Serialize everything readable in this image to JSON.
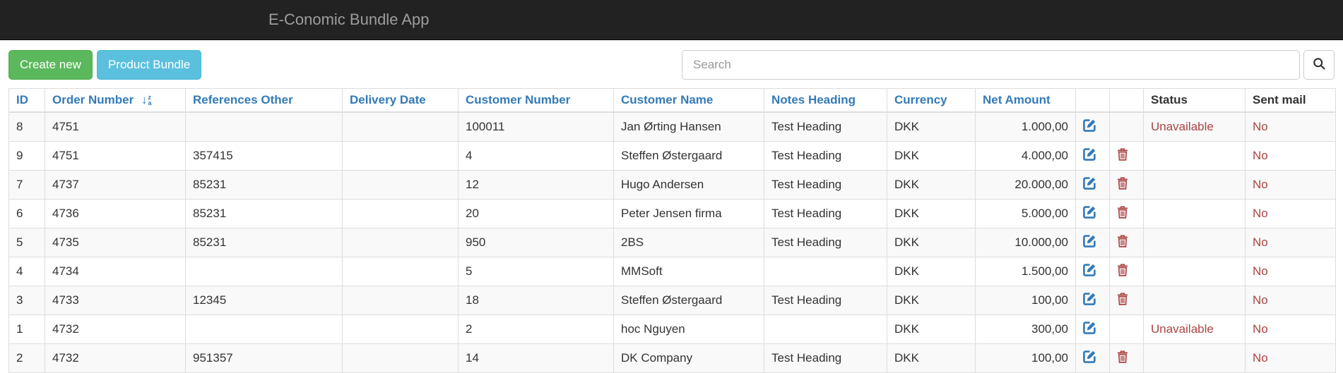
{
  "navbar": {
    "title": "E-Conomic Bundle App",
    "bg_color": "#222222",
    "title_color": "#9d9d9d"
  },
  "toolbar": {
    "create_label": "Create new",
    "bundle_label": "Product Bundle",
    "create_color": "#5cb85c",
    "bundle_color": "#5bc0de",
    "search_placeholder": "Search",
    "search_value": "",
    "search_icon": "magnifier"
  },
  "table": {
    "link_color": "#337ab7",
    "danger_color": "#a94442",
    "stripe_color": "#f9f9f9",
    "sort_icon": "sort-alpha-desc",
    "edit_icon": "pencil-square",
    "delete_icon": "trash",
    "columns": [
      {
        "key": "id",
        "label": "ID",
        "link": true
      },
      {
        "key": "order_number",
        "label": "Order Number",
        "link": true,
        "sorted": true
      },
      {
        "key": "references_other",
        "label": "References Other",
        "link": true
      },
      {
        "key": "delivery_date",
        "label": "Delivery Date",
        "link": true
      },
      {
        "key": "customer_number",
        "label": "Customer Number",
        "link": true
      },
      {
        "key": "customer_name",
        "label": "Customer Name",
        "link": true
      },
      {
        "key": "notes_heading",
        "label": "Notes Heading",
        "link": true
      },
      {
        "key": "currency",
        "label": "Currency",
        "link": true
      },
      {
        "key": "net_amount",
        "label": "Net Amount",
        "link": true,
        "align": "right"
      },
      {
        "key": "edit",
        "label": "",
        "link": false
      },
      {
        "key": "delete",
        "label": "",
        "link": false
      },
      {
        "key": "status",
        "label": "Status",
        "link": false,
        "danger": true
      },
      {
        "key": "sent_mail",
        "label": "Sent mail",
        "link": false,
        "danger": true
      }
    ],
    "rows": [
      {
        "id": "8",
        "order_number": "4751",
        "references_other": "",
        "delivery_date": "",
        "customer_number": "100011",
        "customer_name": "Jan Ørting Hansen",
        "notes_heading": "Test Heading",
        "currency": "DKK",
        "net_amount": "1.000,00",
        "can_edit": true,
        "can_delete": false,
        "status": "Unavailable",
        "sent_mail": "No"
      },
      {
        "id": "9",
        "order_number": "4751",
        "references_other": "357415",
        "delivery_date": "",
        "customer_number": "4",
        "customer_name": "Steffen Østergaard",
        "notes_heading": "Test Heading",
        "currency": "DKK",
        "net_amount": "4.000,00",
        "can_edit": true,
        "can_delete": true,
        "status": "",
        "sent_mail": "No"
      },
      {
        "id": "7",
        "order_number": "4737",
        "references_other": "85231",
        "delivery_date": "",
        "customer_number": "12",
        "customer_name": "Hugo Andersen",
        "notes_heading": "Test Heading",
        "currency": "DKK",
        "net_amount": "20.000,00",
        "can_edit": true,
        "can_delete": true,
        "status": "",
        "sent_mail": "No"
      },
      {
        "id": "6",
        "order_number": "4736",
        "references_other": "85231",
        "delivery_date": "",
        "customer_number": "20",
        "customer_name": "Peter Jensen firma",
        "notes_heading": "Test Heading",
        "currency": "DKK",
        "net_amount": "5.000,00",
        "can_edit": true,
        "can_delete": true,
        "status": "",
        "sent_mail": "No"
      },
      {
        "id": "5",
        "order_number": "4735",
        "references_other": "85231",
        "delivery_date": "",
        "customer_number": "950",
        "customer_name": "2BS",
        "notes_heading": "Test Heading",
        "currency": "DKK",
        "net_amount": "10.000,00",
        "can_edit": true,
        "can_delete": true,
        "status": "",
        "sent_mail": "No"
      },
      {
        "id": "4",
        "order_number": "4734",
        "references_other": "",
        "delivery_date": "",
        "customer_number": "5",
        "customer_name": "MMSoft",
        "notes_heading": "",
        "currency": "DKK",
        "net_amount": "1.500,00",
        "can_edit": true,
        "can_delete": true,
        "status": "",
        "sent_mail": "No"
      },
      {
        "id": "3",
        "order_number": "4733",
        "references_other": "12345",
        "delivery_date": "",
        "customer_number": "18",
        "customer_name": "Steffen Østergaard",
        "notes_heading": "Test Heading",
        "currency": "DKK",
        "net_amount": "100,00",
        "can_edit": true,
        "can_delete": true,
        "status": "",
        "sent_mail": "No"
      },
      {
        "id": "1",
        "order_number": "4732",
        "references_other": "",
        "delivery_date": "",
        "customer_number": "2",
        "customer_name": "hoc Nguyen",
        "notes_heading": "",
        "currency": "DKK",
        "net_amount": "300,00",
        "can_edit": true,
        "can_delete": false,
        "status": "Unavailable",
        "sent_mail": "No"
      },
      {
        "id": "2",
        "order_number": "4732",
        "references_other": "951357",
        "delivery_date": "",
        "customer_number": "14",
        "customer_name": "DK Company",
        "notes_heading": "Test Heading",
        "currency": "DKK",
        "net_amount": "100,00",
        "can_edit": true,
        "can_delete": true,
        "status": "",
        "sent_mail": "No"
      }
    ]
  }
}
